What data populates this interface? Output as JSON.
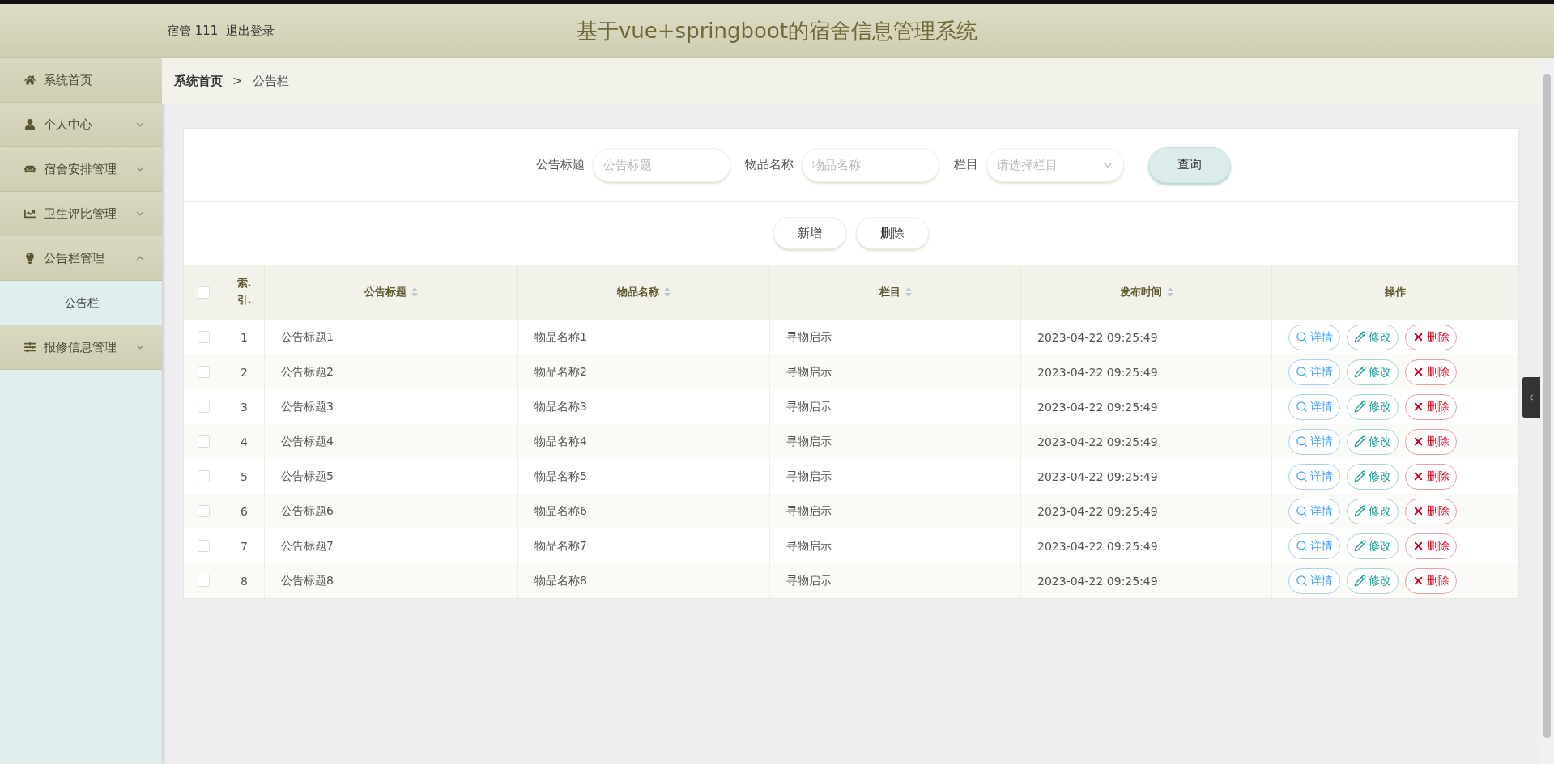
{
  "header": {
    "user": "宿管 111",
    "logout": "退出登录",
    "title": "基于vue+springboot的宿舍信息管理系统"
  },
  "sidebar": {
    "items": [
      {
        "label": "系统首页"
      },
      {
        "label": "个人中心",
        "expanded": false
      },
      {
        "label": "宿舍安排管理",
        "expanded": false
      },
      {
        "label": "卫生评比管理",
        "expanded": false
      },
      {
        "label": "公告栏管理",
        "expanded": true,
        "children": [
          {
            "label": "公告栏"
          }
        ]
      },
      {
        "label": "报修信息管理",
        "expanded": false
      }
    ]
  },
  "breadcrumb": {
    "items": [
      "系统首页",
      "公告栏"
    ],
    "separator": ">"
  },
  "search": {
    "fields": [
      {
        "kind": "input",
        "label": "公告标题",
        "placeholder": "公告标题"
      },
      {
        "kind": "input",
        "label": "物品名称",
        "placeholder": "物品名称"
      },
      {
        "kind": "select",
        "label": "栏目",
        "placeholder": "请选择栏目"
      }
    ],
    "button": "查询"
  },
  "actions": [
    "新增",
    "删除"
  ],
  "table": {
    "select_all": {
      "checked": false
    },
    "columns": [
      {
        "kind": "text",
        "label": "索.引.",
        "sortable": false
      },
      {
        "kind": "text",
        "label": "公告标题",
        "sortable": true
      },
      {
        "kind": "text",
        "label": "物品名称",
        "sortable": true
      },
      {
        "kind": "text",
        "label": "栏目",
        "sortable": true
      },
      {
        "kind": "text",
        "label": "发布时间",
        "sortable": true
      },
      {
        "kind": "text",
        "label": "操作",
        "sortable": false
      }
    ],
    "rows": [
      {
        "checked": false,
        "cells": [
          "1",
          "公告标题1",
          "物品名称1",
          "寻物启示",
          "2023-04-22 09:25:49"
        ],
        "actions": [
          {
            "kind": "view",
            "label": "详情"
          },
          {
            "kind": "edit",
            "label": "修改"
          },
          {
            "kind": "delete",
            "label": "删除"
          }
        ]
      },
      {
        "checked": false,
        "cells": [
          "2",
          "公告标题2",
          "物品名称2",
          "寻物启示",
          "2023-04-22 09:25:49"
        ],
        "actions": [
          {
            "kind": "view",
            "label": "详情"
          },
          {
            "kind": "edit",
            "label": "修改"
          },
          {
            "kind": "delete",
            "label": "删除"
          }
        ]
      },
      {
        "checked": false,
        "cells": [
          "3",
          "公告标题3",
          "物品名称3",
          "寻物启示",
          "2023-04-22 09:25:49"
        ],
        "actions": [
          {
            "kind": "view",
            "label": "详情"
          },
          {
            "kind": "edit",
            "label": "修改"
          },
          {
            "kind": "delete",
            "label": "删除"
          }
        ]
      },
      {
        "checked": false,
        "cells": [
          "4",
          "公告标题4",
          "物品名称4",
          "寻物启示",
          "2023-04-22 09:25:49"
        ],
        "actions": [
          {
            "kind": "view",
            "label": "详情"
          },
          {
            "kind": "edit",
            "label": "修改"
          },
          {
            "kind": "delete",
            "label": "删除"
          }
        ]
      },
      {
        "checked": false,
        "cells": [
          "5",
          "公告标题5",
          "物品名称5",
          "寻物启示",
          "2023-04-22 09:25:49"
        ],
        "actions": [
          {
            "kind": "view",
            "label": "详情"
          },
          {
            "kind": "edit",
            "label": "修改"
          },
          {
            "kind": "delete",
            "label": "删除"
          }
        ]
      },
      {
        "checked": false,
        "cells": [
          "6",
          "公告标题6",
          "物品名称6",
          "寻物启示",
          "2023-04-22 09:25:49"
        ],
        "actions": [
          {
            "kind": "view",
            "label": "详情"
          },
          {
            "kind": "edit",
            "label": "修改"
          },
          {
            "kind": "delete",
            "label": "删除"
          }
        ]
      },
      {
        "checked": false,
        "cells": [
          "7",
          "公告标题7",
          "物品名称7",
          "寻物启示",
          "2023-04-22 09:25:49"
        ],
        "actions": [
          {
            "kind": "view",
            "label": "详情"
          },
          {
            "kind": "edit",
            "label": "修改"
          },
          {
            "kind": "delete",
            "label": "删除"
          }
        ]
      },
      {
        "checked": false,
        "cells": [
          "8",
          "公告标题8",
          "物品名称8",
          "寻物启示",
          "2023-04-22 09:25:49"
        ],
        "actions": [
          {
            "kind": "view",
            "label": "详情"
          },
          {
            "kind": "edit",
            "label": "修改"
          },
          {
            "kind": "delete",
            "label": "删除"
          }
        ]
      }
    ]
  }
}
